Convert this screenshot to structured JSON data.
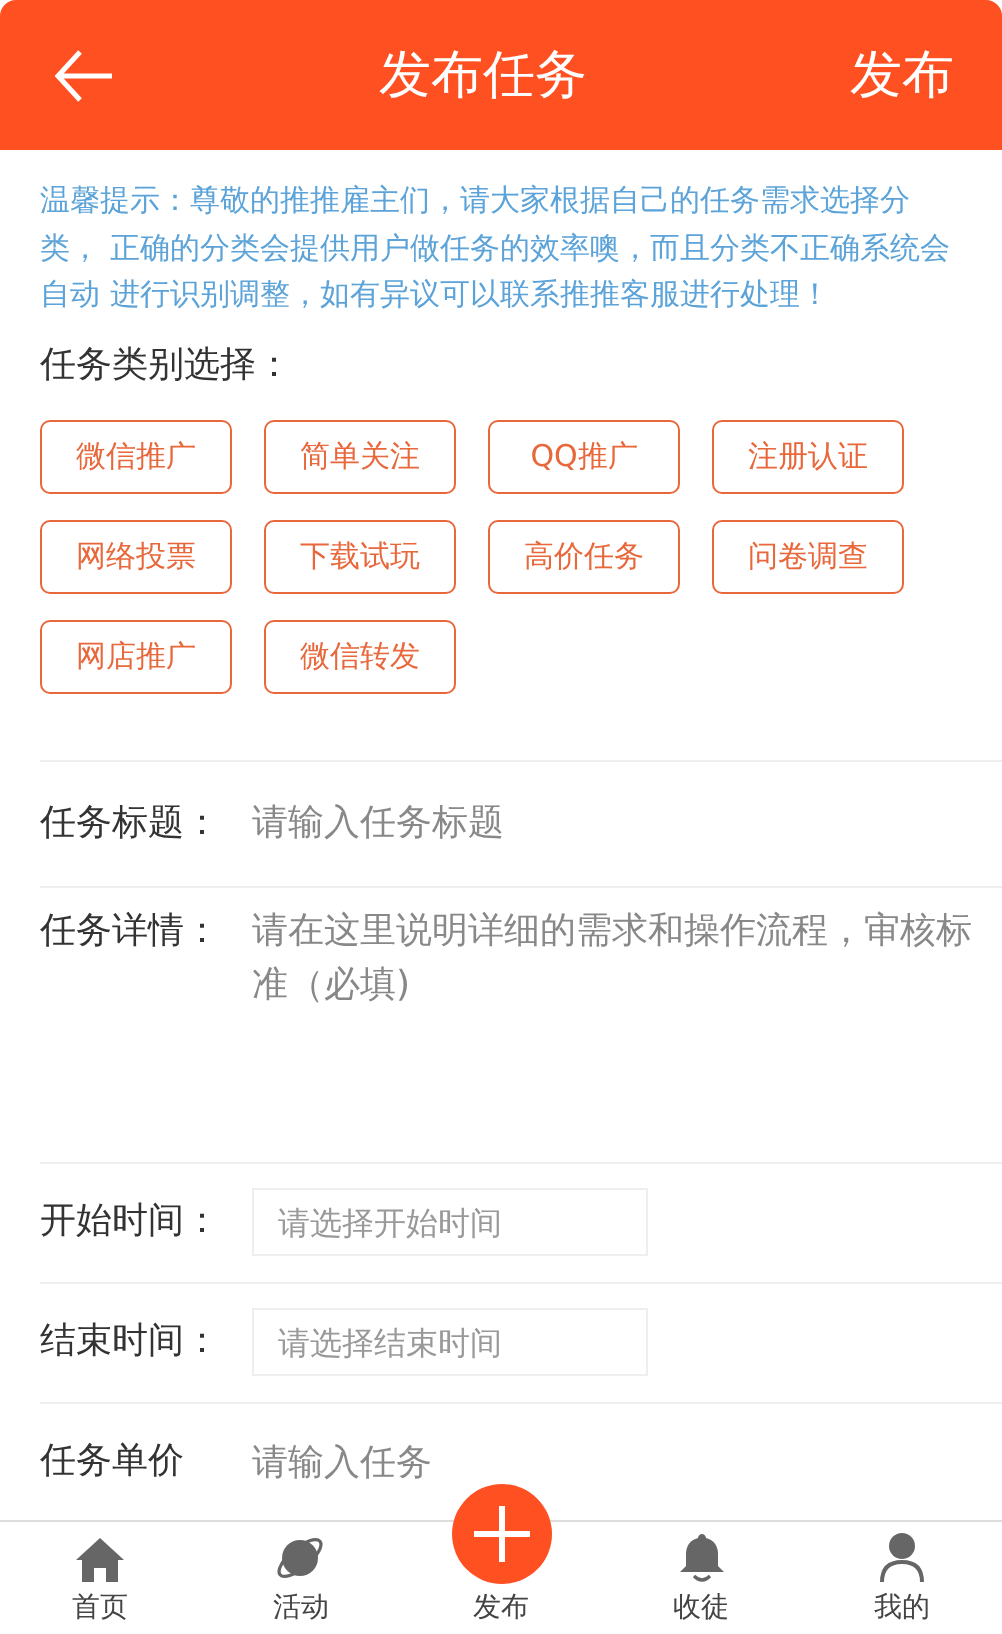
{
  "header": {
    "title": "发布任务",
    "action": "发布"
  },
  "notice": "温馨提示：尊敬的推推雇主们，请大家根据自己的任务需求选择分类， 正确的分类会提供用户做任务的效率噢，而且分类不正确系统会自动 进行识别调整，如有异议可以联系推推客服进行处理！",
  "category": {
    "label": "任务类别选择：",
    "options": [
      "微信推广",
      "简单关注",
      "QQ推广",
      "注册认证",
      "网络投票",
      "下载试玩",
      "高价任务",
      "问卷调查",
      "网店推广",
      "微信转发"
    ]
  },
  "form": [
    {
      "kind": "text",
      "label": "任务标题：",
      "placeholder": "请输入任务标题"
    },
    {
      "kind": "textarea",
      "label": "任务详情：",
      "placeholder": "请在这里说明详细的需求和操作流程，审核标准（必填)"
    },
    {
      "kind": "date",
      "label": "开始时间：",
      "placeholder": "请选择开始时间"
    },
    {
      "kind": "date",
      "label": "结束时间：",
      "placeholder": "请选择结束时间"
    },
    {
      "kind": "text",
      "label": "任务单价",
      "placeholder": "请输入任务"
    }
  ],
  "tab_bar": [
    {
      "kind": "tab",
      "label": "首页"
    },
    {
      "kind": "tab",
      "label": "活动"
    },
    {
      "kind": "publish",
      "label": "发布"
    },
    {
      "kind": "tab",
      "label": "收徒"
    },
    {
      "kind": "tab",
      "label": "我的"
    }
  ]
}
